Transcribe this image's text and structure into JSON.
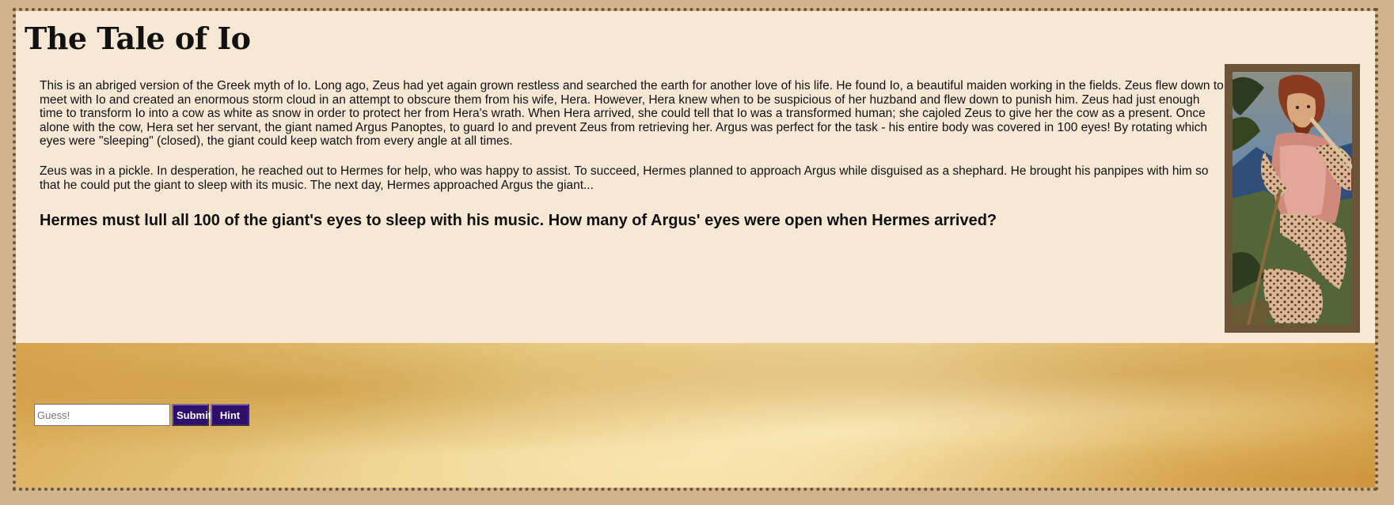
{
  "page": {
    "title": "The Tale of Io"
  },
  "story": {
    "paragraph_1": "This is an abriged version of the Greek myth of Io. Long ago, Zeus had yet again grown restless and searched the earth for another love of his life. He found Io, a beautiful maiden working in the fields. Zeus flew down to meet with Io and created an enormous storm cloud in an attempt to obscure them from his wife, Hera. However, Hera knew when to be suspicious of her huzband and flew down to punish him. Zeus had just enough time to transform Io into a cow as white as snow in order to protect her from Hera's wrath. When Hera arrived, she could tell that Io was a transformed human; she cajoled Zeus to give her the cow as a present. Once alone with the cow, Hera set her servant, the giant named Argus Panoptes, to guard Io and prevent Zeus from retrieving her. Argus was perfect for the task - his entire body was covered in 100 eyes! By rotating which eyes were \"sleeping\" (closed), the giant could keep watch from every angle at all times.",
    "paragraph_2": "Zeus was in a pickle. In desperation, he reached out to Hermes for help, who was happy to assist. To succeed, Hermes planned to approach Argus while disguised as a shephard. He brought his panpipes with him so that he could put the giant to sleep with its music. The next day, Hermes approached Argus the giant...",
    "question": "Hermes must lull all 100 of the giant's eyes to sleep with his music. How many of Argus' eyes were open when Hermes arrived?"
  },
  "illustration": {
    "subject": "painting-of-argus-panoptes",
    "frame_color": "#6b5437"
  },
  "form": {
    "guess_placeholder": "Guess!",
    "guess_value": "",
    "submit_label": "Submit",
    "hint_label": "Hint"
  },
  "colors": {
    "page_background": "#d2b48c",
    "panel_background": "#f7e8d6",
    "border": "#6b5437",
    "button_background": "#2e0f6b",
    "button_text": "#ffffff"
  }
}
